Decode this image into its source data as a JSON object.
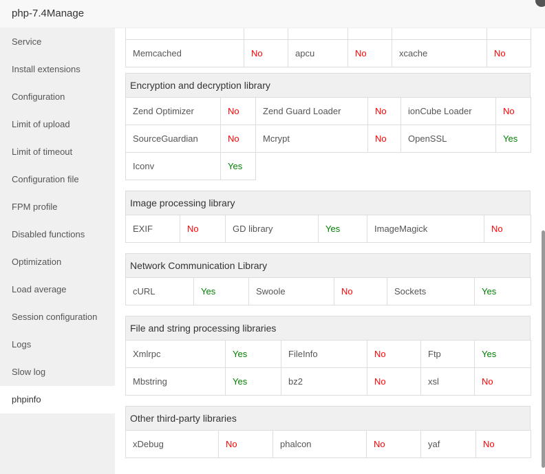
{
  "window": {
    "title": "php-7.4Manage"
  },
  "sidebar": {
    "active": "phpinfo",
    "items": [
      "Service",
      "Install extensions",
      "Configuration",
      "Limit of upload",
      "Limit of timeout",
      "Configuration file",
      "FPM profile",
      "Disabled functions",
      "Optimization",
      "Load average",
      "Session configuration",
      "Logs",
      "Slow log",
      "phpinfo"
    ]
  },
  "colors": {
    "yes": "#008000",
    "no": "#ff0000"
  },
  "sections": [
    {
      "title": "",
      "rows": [
        [
          [
            "Memcached",
            "No"
          ],
          [
            "apcu",
            "No"
          ],
          [
            "xcache",
            "No"
          ]
        ]
      ]
    },
    {
      "title": "Encryption and decryption library",
      "rows": [
        [
          [
            "Zend Optimizer",
            "No"
          ],
          [
            "Zend Guard Loader",
            "No"
          ],
          [
            "ionCube Loader",
            "No"
          ]
        ],
        [
          [
            "SourceGuardian",
            "No"
          ],
          [
            "Mcrypt",
            "No"
          ],
          [
            "OpenSSL",
            "Yes"
          ]
        ],
        [
          [
            "Iconv",
            "Yes"
          ]
        ]
      ]
    },
    {
      "title": "Image processing library",
      "rows": [
        [
          [
            "EXIF",
            "No"
          ],
          [
            "GD library",
            "Yes"
          ],
          [
            "ImageMagick",
            "No"
          ]
        ]
      ]
    },
    {
      "title": "Network Communication Library",
      "rows": [
        [
          [
            "cURL",
            "Yes"
          ],
          [
            "Swoole",
            "No"
          ],
          [
            "Sockets",
            "Yes"
          ]
        ]
      ]
    },
    {
      "title": "File and string processing libraries",
      "rows": [
        [
          [
            "Xmlrpc",
            "Yes"
          ],
          [
            "FileInfo",
            "No"
          ],
          [
            "Ftp",
            "Yes"
          ]
        ],
        [
          [
            "Mbstring",
            "Yes"
          ],
          [
            "bz2",
            "No"
          ],
          [
            "xsl",
            "No"
          ]
        ]
      ]
    },
    {
      "title": "Other third-party libraries",
      "rows": [
        [
          [
            "xDebug",
            "No"
          ],
          [
            "phalcon",
            "No"
          ],
          [
            "yaf",
            "No"
          ]
        ]
      ]
    }
  ]
}
